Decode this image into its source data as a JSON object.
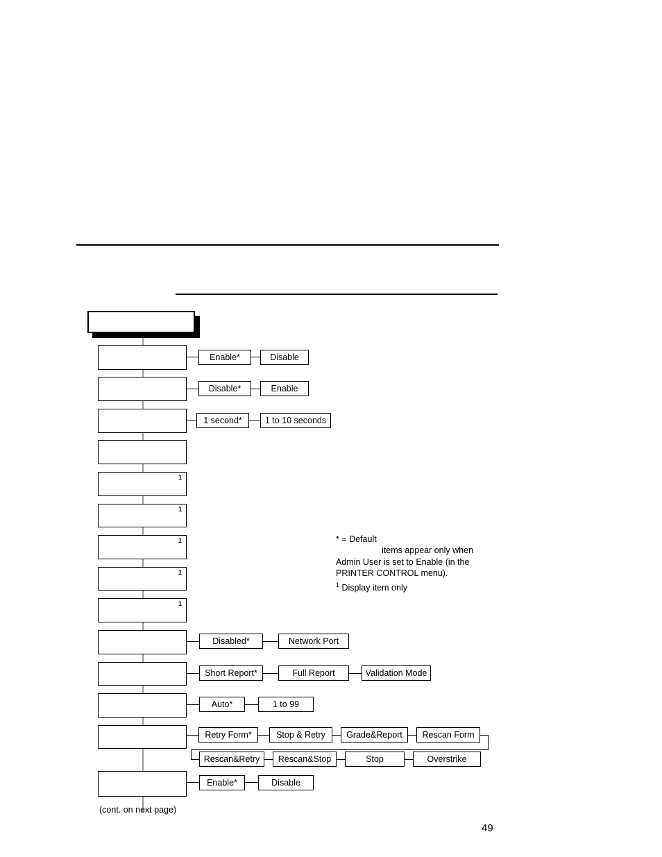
{
  "page": {
    "number": "49",
    "continuation_note": "(cont. on next page)"
  },
  "diagram": {
    "header_box_label": "",
    "menu_items": [
      {
        "label": "",
        "superscript": "",
        "options": [
          "Enable*",
          "Disable"
        ]
      },
      {
        "label": "",
        "superscript": "",
        "options": [
          "Disable*",
          "Enable"
        ]
      },
      {
        "label": "",
        "superscript": "",
        "options": [
          "1 second*",
          "1 to 10 seconds"
        ]
      },
      {
        "label": "",
        "superscript": "",
        "options": []
      },
      {
        "label": "",
        "superscript": "1",
        "options": []
      },
      {
        "label": "",
        "superscript": "1",
        "options": []
      },
      {
        "label": "",
        "superscript": "1",
        "options": []
      },
      {
        "label": "",
        "superscript": "1",
        "options": []
      },
      {
        "label": "",
        "superscript": "1",
        "options": []
      },
      {
        "label": "",
        "superscript": "",
        "options": [
          "Disabled*",
          "Network Port"
        ]
      },
      {
        "label": "",
        "superscript": "",
        "options": [
          "Short Report*",
          "Full Report",
          "Validation Mode"
        ]
      },
      {
        "label": "",
        "superscript": "",
        "options": [
          "Auto*",
          "1 to 99"
        ]
      },
      {
        "label": "",
        "superscript": "",
        "options": [
          "Retry Form*",
          "Stop & Retry",
          "Grade&Report",
          "Rescan Form",
          "Rescan&Retry",
          "Rescan&Stop",
          "Stop",
          "Overstrike"
        ]
      },
      {
        "label": "",
        "superscript": "",
        "options": [
          "Enable*",
          "Disable"
        ]
      }
    ]
  },
  "legend": {
    "line1": "* = Default",
    "line2": "items appear only when",
    "line3": "Admin User is set to Enable (in the",
    "line4": "PRINTER CONTROL menu).",
    "line5_sup": "1",
    "line5": " Display item only"
  }
}
